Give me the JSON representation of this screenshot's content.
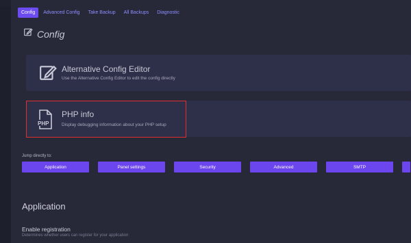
{
  "tabs": [
    {
      "label": "Config",
      "active": true
    },
    {
      "label": "Advanced Config",
      "active": false
    },
    {
      "label": "Take Backup",
      "active": false
    },
    {
      "label": "All Backups",
      "active": false
    },
    {
      "label": "Diagnostic",
      "active": false
    }
  ],
  "page": {
    "title": "Config",
    "title_icon": "edit-icon"
  },
  "cards": {
    "config_editor": {
      "title": "Alternative Config Editor",
      "description": "Use the Alternative Config Editor to edit the config directly",
      "icon": "edit-icon"
    },
    "php_info": {
      "title": "PHP info",
      "description": "Display debugging information about your PHP setup",
      "icon": "php-file-icon",
      "icon_text": "PHP"
    }
  },
  "jump": {
    "label": "Jump directly to:",
    "buttons": [
      "Application",
      "Panel settings",
      "Security",
      "Advanced",
      "SMTP"
    ]
  },
  "section": {
    "title": "Application",
    "setting_label": "Enable registration",
    "setting_description": "Determines whether users can register for your application"
  },
  "colors": {
    "accent": "#6b45ee",
    "highlight": "#e0302f",
    "card_bg": "#2e2f48",
    "panel_bg": "#272838"
  }
}
